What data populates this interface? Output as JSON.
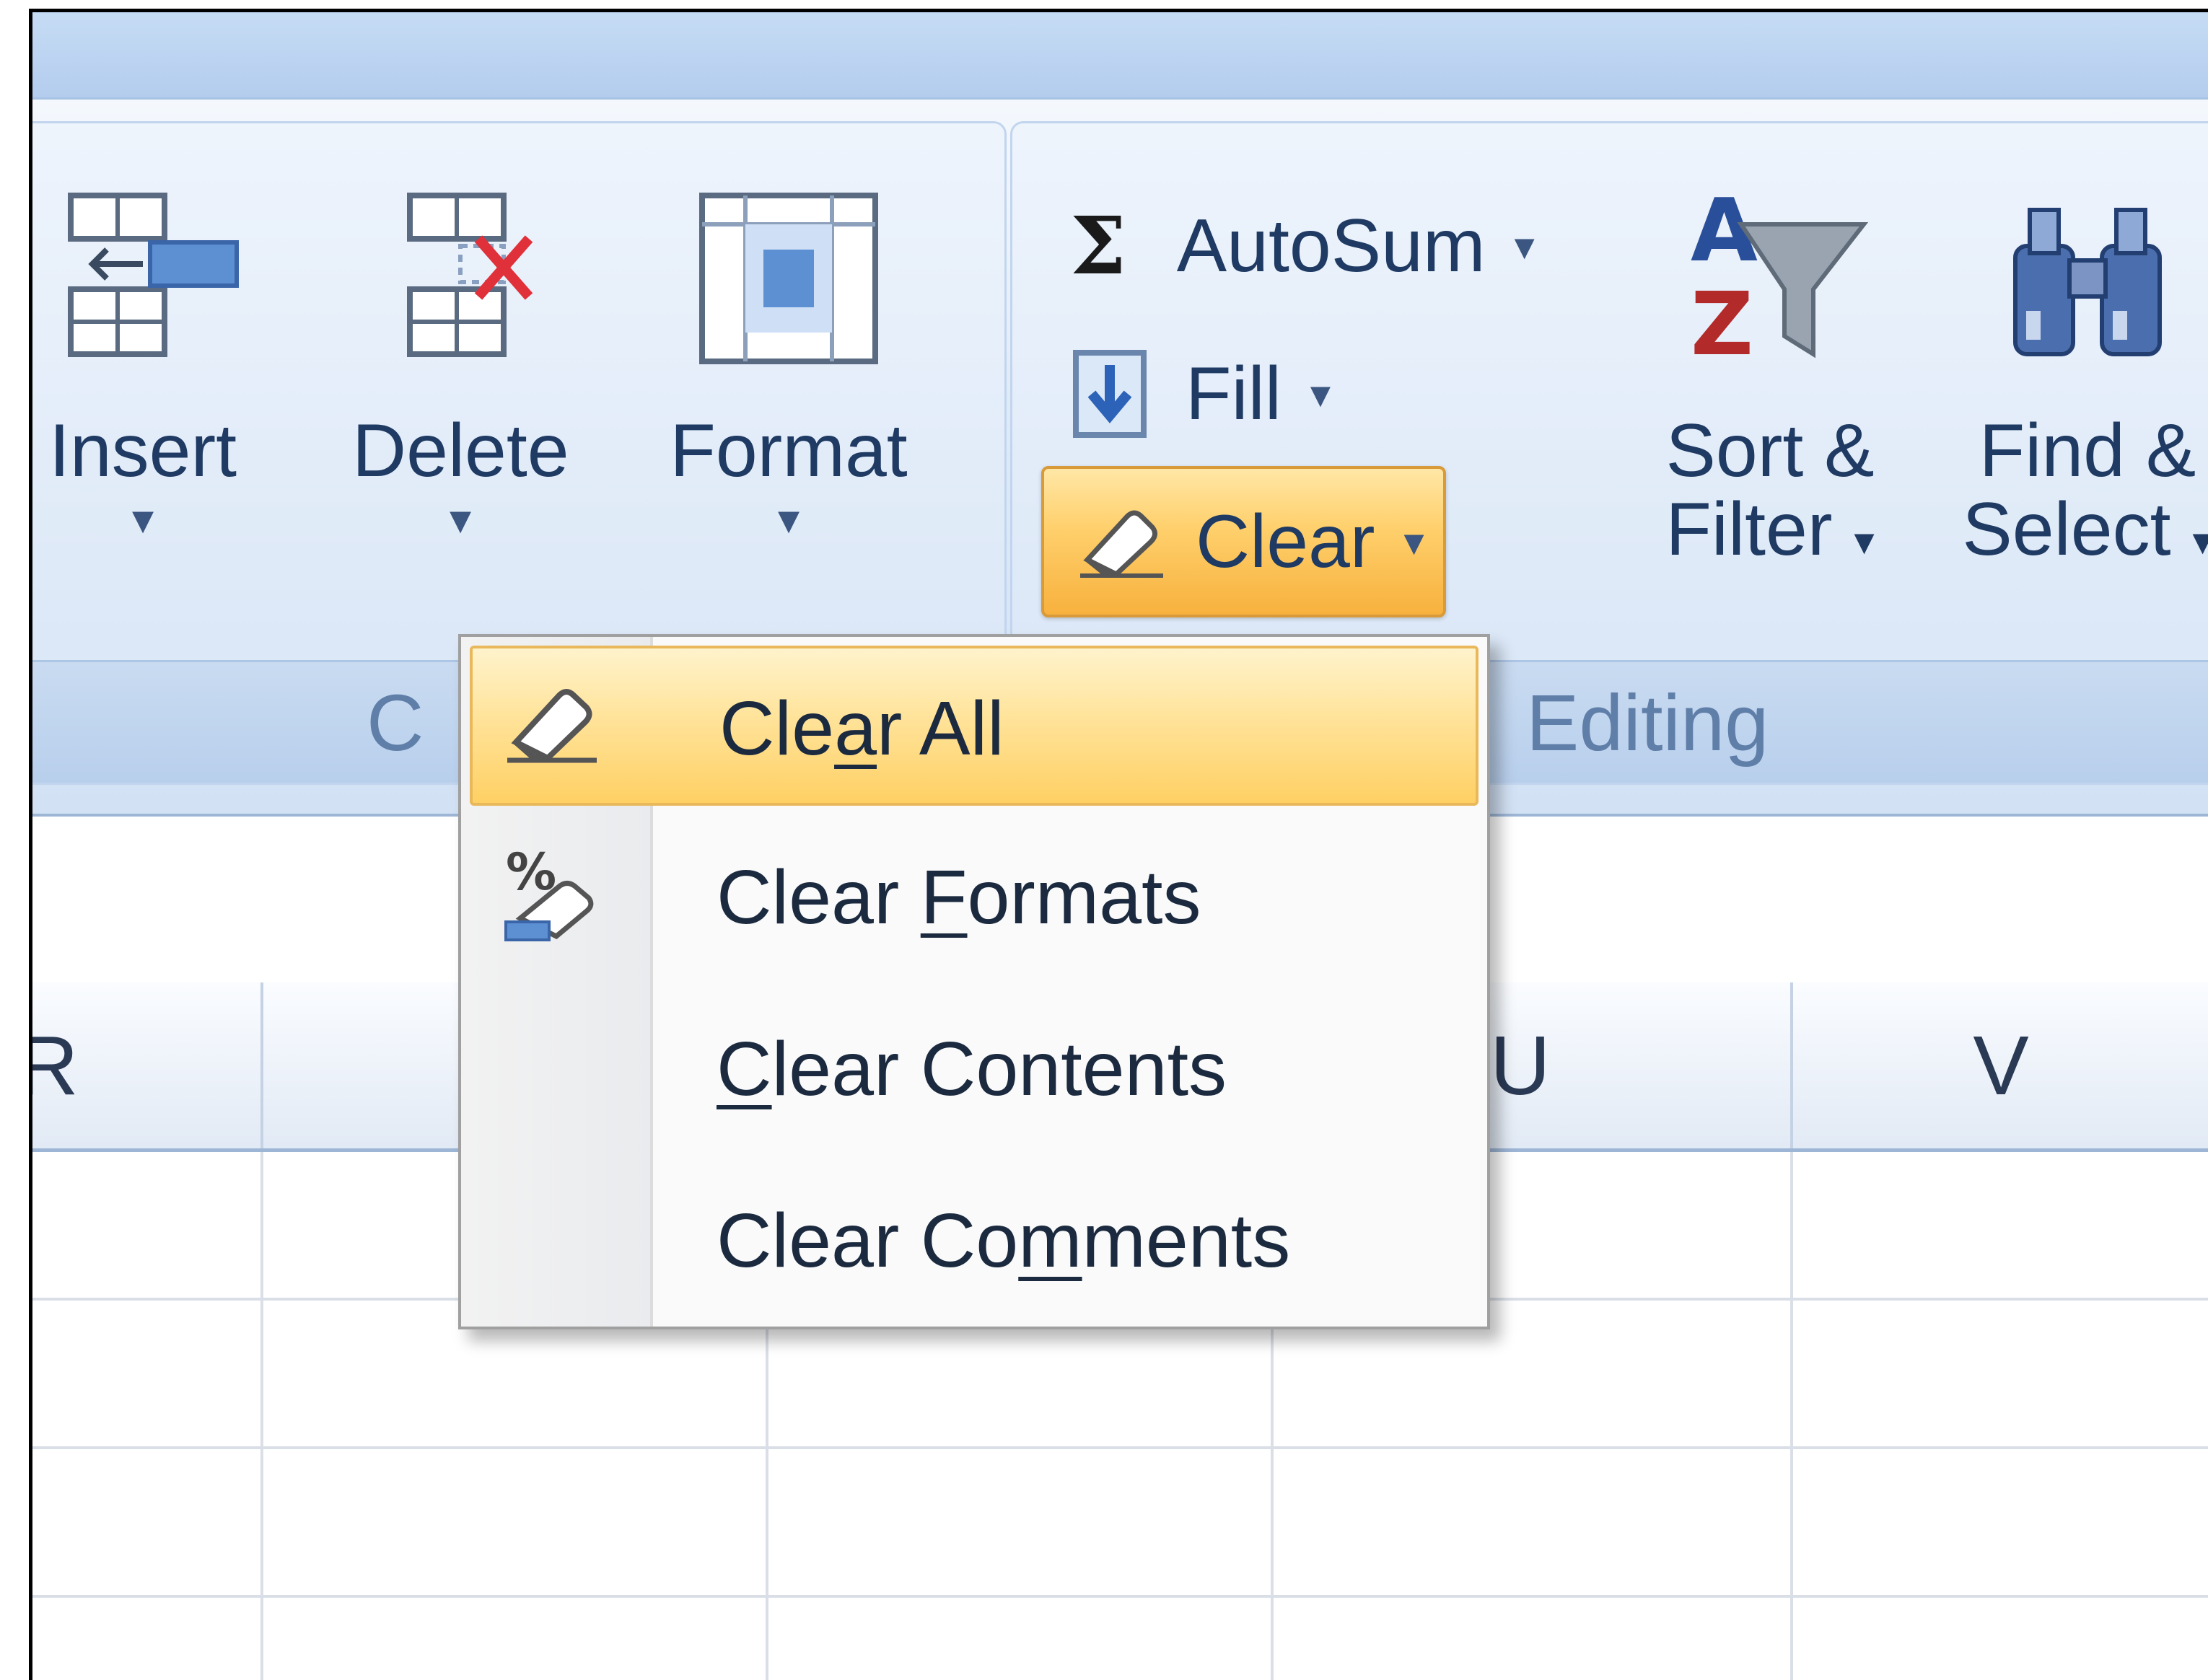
{
  "ribbon": {
    "cells_group": {
      "label": "C",
      "buttons": [
        {
          "label": "Insert",
          "dropdown": "▾"
        },
        {
          "label": "Delete",
          "dropdown": "▾"
        },
        {
          "label": "Format",
          "dropdown": "▾"
        }
      ]
    },
    "editing_group": {
      "label": "Editing",
      "autosum": {
        "symbol": "Σ",
        "label": "AutoSum",
        "dropdown": "▾"
      },
      "fill": {
        "label": "Fill",
        "dropdown": "▾"
      },
      "clear": {
        "label": "Clear",
        "dropdown": "▾"
      },
      "sort_filter": {
        "line1": "Sort &",
        "line2": "Filter",
        "dropdown": "▾"
      },
      "find_select": {
        "line1": "Find &",
        "line2": "Select",
        "dropdown": "▾"
      }
    }
  },
  "columns": {
    "r": "R",
    "u": "U",
    "v": "V"
  },
  "clear_menu": {
    "items": [
      {
        "pre": "Cle",
        "accel": "a",
        "post": "r All",
        "icon": "eraser-icon",
        "highlighted": true
      },
      {
        "pre": "Clear ",
        "accel": "F",
        "post": "ormats",
        "icon": "clear-formats-icon",
        "highlighted": false
      },
      {
        "pre": "",
        "accel": "C",
        "post": "lear Contents",
        "icon": "",
        "highlighted": false
      },
      {
        "pre": "Clear Co",
        "accel": "m",
        "post": "ments",
        "icon": "",
        "highlighted": false
      }
    ]
  },
  "colors": {
    "highlight": "#ffd064",
    "ribbon_blue": "#d2e1f4",
    "label_blue": "#5f7ea8"
  }
}
